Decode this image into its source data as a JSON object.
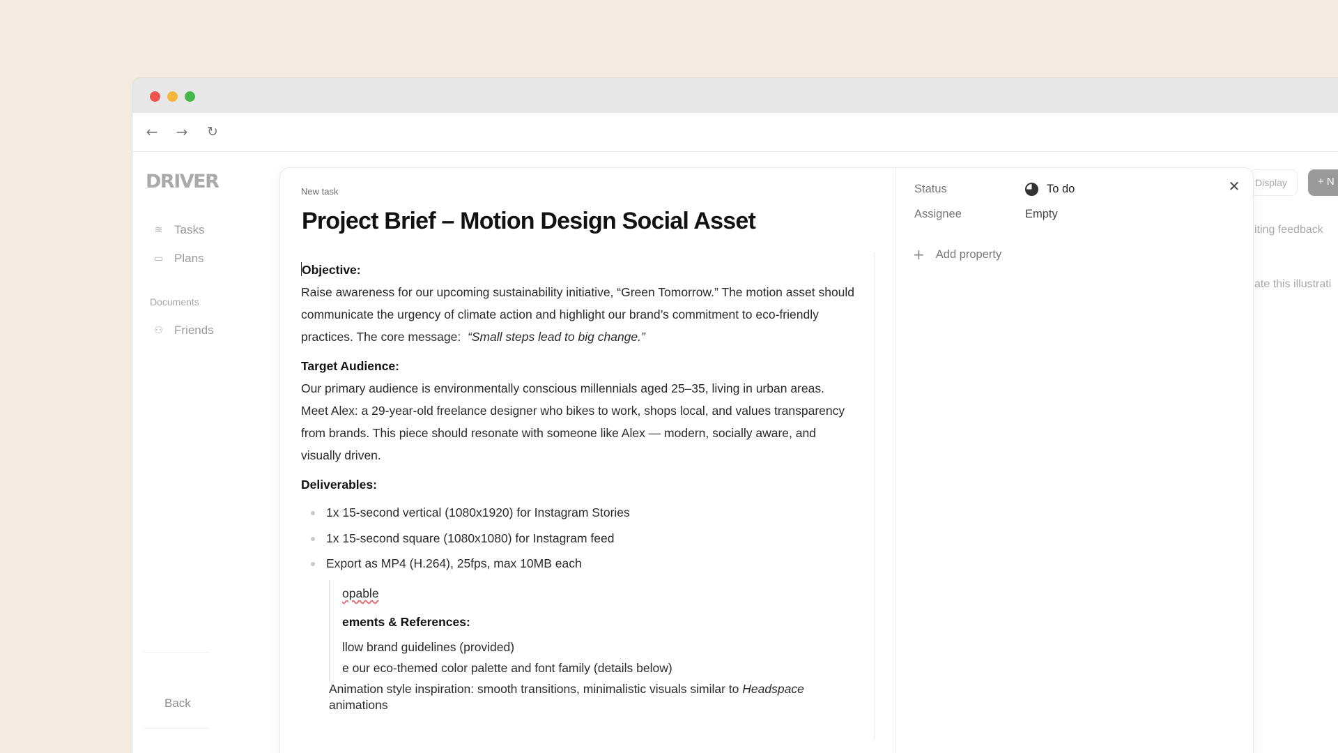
{
  "app": {
    "logo": "DRIVER"
  },
  "browser": {
    "back_icon": "←",
    "forward_icon": "→",
    "reload_icon": "↻"
  },
  "sidebar": {
    "items": [
      {
        "label": "Tasks",
        "icon": "layers-icon",
        "glyph": "≋"
      },
      {
        "label": "Plans",
        "icon": "calendar-icon",
        "glyph": "▭"
      }
    ],
    "section": "Documents",
    "section_items": [
      {
        "label": "Friends",
        "icon": "users-icon",
        "glyph": "⚇"
      }
    ],
    "back_label": "Back"
  },
  "background": {
    "display_label": "Display",
    "new_label": "+ N",
    "text1": "iting feedback",
    "text2": "ate this illustrati"
  },
  "modal": {
    "label": "New task",
    "title": "Project Brief – Motion Design Social Asset",
    "objective_heading": "Objective:",
    "objective_text": "Raise awareness for our upcoming sustainability initiative, “Green Tomorrow.” The motion asset should communicate the urgency of climate action and highlight our brand’s commitment to eco-friendly practices. The core message:",
    "objective_quote": "“Small steps lead to big change.”",
    "audience_heading": "Target Audience:",
    "audience_text_1": "Our primary audience is environmentally conscious millennials aged 25–35, living in urban areas.",
    "audience_text_2": "Meet Alex: a 29-year-old freelance designer who bikes to work, shops local, and values transparency from brands. This piece should resonate with someone like Alex — modern, socially aware, and visually driven.",
    "deliverables_heading": "Deliverables:",
    "deliverables": [
      "1x 15-second vertical (1080x1920) for Instagram Stories",
      "1x 15-second square (1080x1080) for Instagram feed",
      "Export as MP4 (H.264), 25fps, max 10MB each"
    ],
    "fragments": {
      "f1": "opable",
      "f2": "ements & References:",
      "f3": "llow brand guidelines (provided)",
      "f4": "e our eco-themed color palette and font family (details below)",
      "f5_text": "Animation style inspiration: smooth transitions, minimalistic visuals similar to ",
      "f5_italic": "Headspace",
      "f6": "animations"
    }
  },
  "panel": {
    "status_label": "Status",
    "status_value": "To do",
    "assignee_label": "Assignee",
    "assignee_value": "Empty",
    "add_property": "Add property",
    "close_icon": "✕"
  }
}
